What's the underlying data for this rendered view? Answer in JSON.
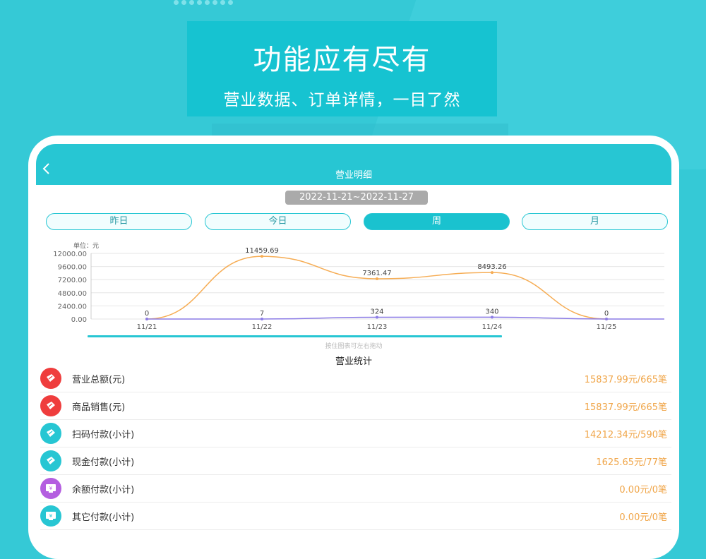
{
  "banner": {
    "title": "功能应有尽有",
    "subtitle": "营业数据、订单详情，一目了然"
  },
  "app": {
    "header_title": "营业明细",
    "back_icon": "chevron-left-icon",
    "date_range": "2022-11-21~2022-11-27",
    "tabs": [
      {
        "label": "昨日",
        "active": false
      },
      {
        "label": "今日",
        "active": false
      },
      {
        "label": "周",
        "active": true
      },
      {
        "label": "月",
        "active": false
      }
    ],
    "chart_hint": "按住图表可左右拖动",
    "stats_title": "营业统计",
    "stats": [
      {
        "label": "营业总额(元)",
        "value": "15837.99元/665笔",
        "icon": "ticket-icon",
        "color": "#ef3d3d"
      },
      {
        "label": "商品销售(元)",
        "value": "15837.99元/665笔",
        "icon": "ticket-icon",
        "color": "#ef3d3d"
      },
      {
        "label": "扫码付款(小计)",
        "value": "14212.34元/590笔",
        "icon": "ticket-icon",
        "color": "#27c6d3"
      },
      {
        "label": "现金付款(小计)",
        "value": "1625.65元/77笔",
        "icon": "ticket-icon",
        "color": "#27c6d3"
      },
      {
        "label": "余额付款(小计)",
        "value": "0.00元/0笔",
        "icon": "wallet-icon",
        "color": "#b45ee0"
      },
      {
        "label": "其它付款(小计)",
        "value": "0.00元/0笔",
        "icon": "wallet-icon",
        "color": "#27c6d3"
      }
    ]
  },
  "colors": {
    "accent": "#27c6d3",
    "amount_line": "#f6ad55",
    "count_line": "#8c7ce6",
    "value_text": "#f0a548"
  },
  "chart_data": {
    "type": "line",
    "unit_label": "单位：元",
    "categories": [
      "11/21",
      "11/22",
      "11/23",
      "11/24",
      "11/25"
    ],
    "yticks": [
      "12000.00",
      "9600.00",
      "7200.00",
      "4800.00",
      "2400.00",
      "0.00"
    ],
    "ylim": [
      0,
      12000
    ],
    "series": [
      {
        "values": [
          0,
          11459.69,
          7361.47,
          8493.26,
          0
        ],
        "labels": [
          "0",
          "11459.69",
          "7361.47",
          "8493.26",
          "0"
        ]
      },
      {
        "values": [
          0,
          7,
          324,
          340,
          0
        ],
        "labels": [
          "",
          "7",
          "324",
          "340",
          ""
        ]
      }
    ],
    "grid": true
  }
}
